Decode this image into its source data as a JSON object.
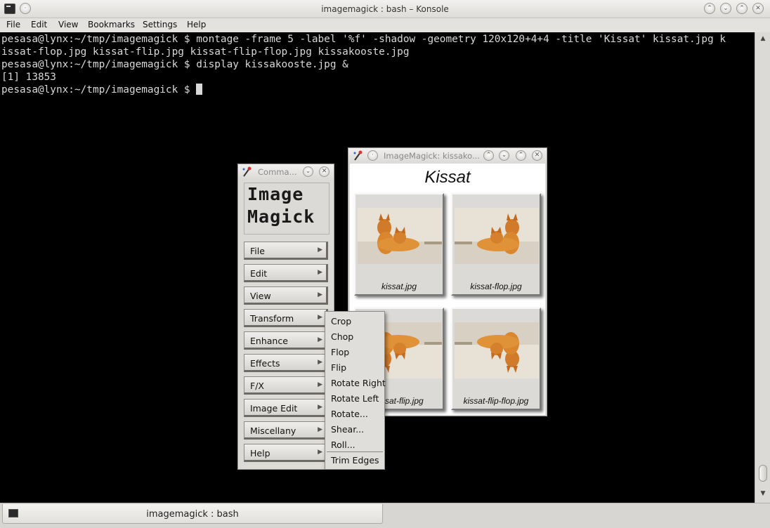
{
  "konsole": {
    "title": "imagemagick : bash – Konsole",
    "menu": [
      "File",
      "Edit",
      "View",
      "Bookmarks",
      "Settings",
      "Help"
    ],
    "terminal_lines": [
      "pesasa@lynx:~/tmp/imagemagick $ montage -frame 5 -label '%f' -shadow -geometry 120x120+4+4 -title 'Kissat' kissat.jpg k",
      "issat-flop.jpg kissat-flip.jpg kissat-flip-flop.jpg kissakooste.jpg",
      "pesasa@lynx:~/tmp/imagemagick $ display kissakooste.jpg &",
      "[1] 13853",
      "pesasa@lynx:~/tmp/imagemagick $ "
    ],
    "tab_label": "imagemagick : bash"
  },
  "commands_window": {
    "title": "Comma...",
    "logo_line1": "Image",
    "logo_line2": "Magick",
    "buttons": [
      "File",
      "Edit",
      "View",
      "Transform",
      "Enhance",
      "Effects",
      "F/X",
      "Image Edit",
      "Miscellany",
      "Help"
    ]
  },
  "transform_menu": {
    "items": [
      "Crop",
      "Chop",
      "Flop",
      "Flip",
      "Rotate Right",
      "Rotate Left",
      "Rotate...",
      "Shear...",
      "Roll...",
      "Trim Edges"
    ]
  },
  "display_window": {
    "title": "ImageMagick: kissako...",
    "montage_title": "Kissat",
    "tiles": [
      "kissat.jpg",
      "kissat-flop.jpg",
      "kissat-flip.jpg",
      "kissat-flip-flop.jpg"
    ],
    "tile_caption_3_visible": "sat-flip.jpg"
  },
  "colors": {
    "terminal_bg": "#000000",
    "terminal_fg": "#d8d8d8",
    "window_bg": "#dcdad6"
  }
}
